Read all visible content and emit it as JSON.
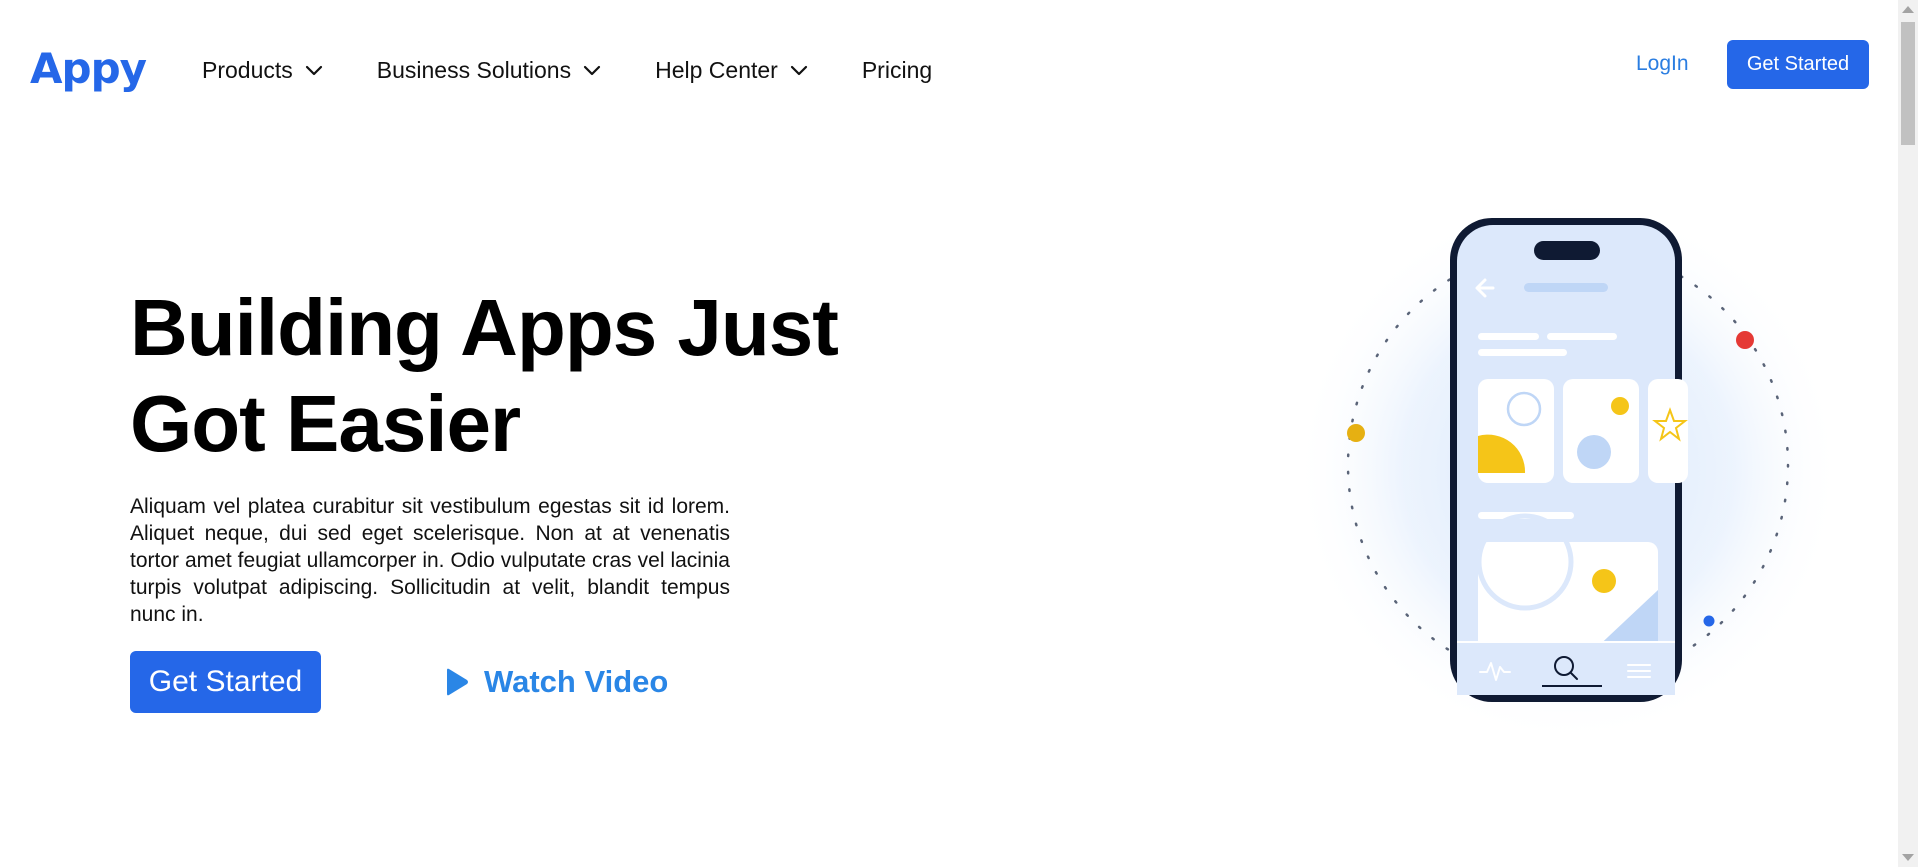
{
  "header": {
    "logo": "Appy",
    "nav": [
      {
        "label": "Products",
        "has_dropdown": true
      },
      {
        "label": "Business Solutions",
        "has_dropdown": true
      },
      {
        "label": "Help Center",
        "has_dropdown": true
      },
      {
        "label": "Pricing",
        "has_dropdown": false
      }
    ],
    "login_label": "LogIn",
    "cta_label": "Get Started"
  },
  "hero": {
    "title_line1": "Building Apps Just",
    "title_line2": "Got Easier",
    "description": "Aliquam vel platea curabitur sit vestibulum egestas sit id lorem. Aliquet neque, dui sed eget scelerisque. Non at at venenatis tortor amet feugiat ullamcorper in. Odio vulputate cras vel lacinia turpis volutpat adipiscing. Sollicitudin at velit, blandit tempus nunc in.",
    "cta_label": "Get Started",
    "watch_label": "Watch Video"
  },
  "illustration": {
    "icon": "phone-app-illustration",
    "colors": {
      "frame": "#0f1a33",
      "screen": "#dce8fb",
      "accent_yellow": "#f5c518",
      "accent_red": "#e53935",
      "accent_blue": "#2567e8",
      "light_blue": "#bfd6f6"
    }
  },
  "colors": {
    "brand": "#2567e8",
    "link": "#2a7de1",
    "text": "#111111"
  }
}
